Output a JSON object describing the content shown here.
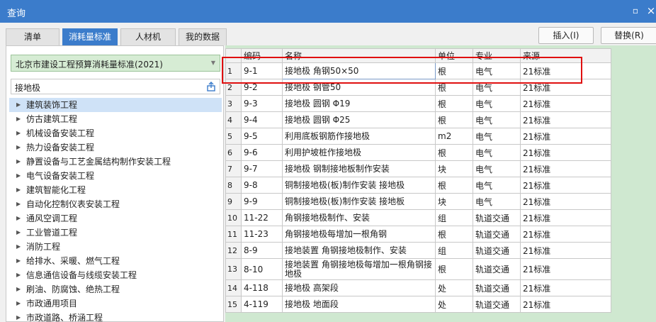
{
  "window": {
    "title": "查询",
    "min_glyph": "▫",
    "close_glyph": "×"
  },
  "tabs": [
    {
      "label": "清单",
      "active": false
    },
    {
      "label": "消耗量标准",
      "active": true
    },
    {
      "label": "人材机",
      "active": false
    },
    {
      "label": "我的数据",
      "active": false
    }
  ],
  "actions": {
    "insert": "插入(I)",
    "replace": "替换(R)"
  },
  "left": {
    "standard": "北京市建设工程预算消耗量标准(2021)",
    "search_value": "接地极",
    "tree": [
      {
        "label": "建筑装饰工程",
        "selected": true
      },
      {
        "label": "仿古建筑工程"
      },
      {
        "label": "机械设备安装工程"
      },
      {
        "label": "热力设备安装工程"
      },
      {
        "label": "静置设备与工艺金属结构制作安装工程"
      },
      {
        "label": "电气设备安装工程"
      },
      {
        "label": "建筑智能化工程"
      },
      {
        "label": "自动化控制仪表安装工程"
      },
      {
        "label": "通风空调工程"
      },
      {
        "label": "工业管道工程"
      },
      {
        "label": "消防工程"
      },
      {
        "label": "给排水、采暖、燃气工程"
      },
      {
        "label": "信息通信设备与线缆安装工程"
      },
      {
        "label": "刷油、防腐蚀、绝热工程"
      },
      {
        "label": "市政通用项目"
      },
      {
        "label": "市政道路、桥涵工程"
      }
    ]
  },
  "grid": {
    "headers": {
      "code": "编码",
      "name": "名称",
      "unit": "单位",
      "major": "专业",
      "source": "来源"
    },
    "rows": [
      {
        "n": "1",
        "code": "9-1",
        "name": "接地极 角钢50×50",
        "unit": "根",
        "major": "电气",
        "source": "21标准"
      },
      {
        "n": "2",
        "code": "9-2",
        "name": "接地极 钢管50",
        "unit": "根",
        "major": "电气",
        "source": "21标准"
      },
      {
        "n": "3",
        "code": "9-3",
        "name": "接地极 圆钢 Φ19",
        "unit": "根",
        "major": "电气",
        "source": "21标准"
      },
      {
        "n": "4",
        "code": "9-4",
        "name": "接地极 圆钢 Φ25",
        "unit": "根",
        "major": "电气",
        "source": "21标准"
      },
      {
        "n": "5",
        "code": "9-5",
        "name": "利用底板钢筋作接地极",
        "unit": "m2",
        "major": "电气",
        "source": "21标准"
      },
      {
        "n": "6",
        "code": "9-6",
        "name": "利用护坡桩作接地极",
        "unit": "根",
        "major": "电气",
        "source": "21标准"
      },
      {
        "n": "7",
        "code": "9-7",
        "name": "接地极 钢制接地板制作安装",
        "unit": "块",
        "major": "电气",
        "source": "21标准"
      },
      {
        "n": "8",
        "code": "9-8",
        "name": "铜制接地极(板)制作安装 接地极",
        "unit": "根",
        "major": "电气",
        "source": "21标准"
      },
      {
        "n": "9",
        "code": "9-9",
        "name": "铜制接地极(板)制作安装 接地板",
        "unit": "块",
        "major": "电气",
        "source": "21标准"
      },
      {
        "n": "10",
        "code": "11-22",
        "name": "角钢接地极制作、安装",
        "unit": "组",
        "major": "轨道交通",
        "source": "21标准"
      },
      {
        "n": "11",
        "code": "11-23",
        "name": "角钢接地极每增加一根角钢",
        "unit": "根",
        "major": "轨道交通",
        "source": "21标准"
      },
      {
        "n": "12",
        "code": "8-9",
        "name": "接地装置 角钢接地极制作、安装",
        "unit": "组",
        "major": "轨道交通",
        "source": "21标准"
      },
      {
        "n": "13",
        "code": "8-10",
        "name": "接地装置 角钢接地极每增加一根角钢接地极",
        "unit": "根",
        "major": "轨道交通",
        "source": "21标准"
      },
      {
        "n": "14",
        "code": "4-118",
        "name": "接地极 高架段",
        "unit": "处",
        "major": "轨道交通",
        "source": "21标准"
      },
      {
        "n": "15",
        "code": "4-119",
        "name": "接地极 地面段",
        "unit": "处",
        "major": "轨道交通",
        "source": "21标准"
      }
    ]
  },
  "colors": {
    "title_bar": "#3b7ccb",
    "active_tab": "#3b7ccb",
    "highlight_box": "#e01010",
    "grid_bg": "#cfe8d0",
    "dropdown_bg": "#d6ecd4"
  }
}
